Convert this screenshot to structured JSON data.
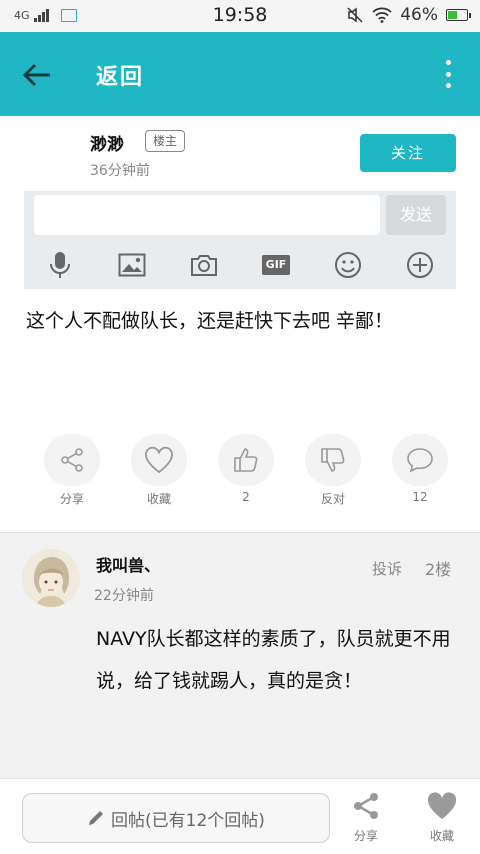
{
  "status_bar": {
    "network": "4G",
    "time": "19:58",
    "battery": "46%",
    "battery_level": 0.46
  },
  "header": {
    "back_icon": "arrow-left-icon",
    "title": "返回",
    "more_icon": "more-vertical-icon",
    "bg_color": "#1fb7c4"
  },
  "post": {
    "author": "渺渺",
    "badge": "楼主",
    "time": "36分钟前",
    "follow_label": "关注",
    "body": "这个人不配做队长，还是赶快下去吧 辛鄙！"
  },
  "composer": {
    "send_label": "发送",
    "tools": [
      "microphone-icon",
      "image-icon",
      "camera-icon",
      "gif-icon",
      "emoji-icon",
      "plus-icon"
    ],
    "gif_label": "GIF"
  },
  "actions": [
    {
      "icon": "share-icon",
      "label": "分享"
    },
    {
      "icon": "heart-icon",
      "label": "收藏"
    },
    {
      "icon": "thumbs-up-icon",
      "label": "2"
    },
    {
      "icon": "thumbs-down-icon",
      "label": "反对"
    },
    {
      "icon": "comment-icon",
      "label": "12"
    }
  ],
  "reply": {
    "author": "我叫兽、",
    "time": "22分钟前",
    "report_label": "投诉",
    "floor": "2楼",
    "body": "NAVY队长都这样的素质了，队员就更不用说，给了钱就踢人，真的是贪！"
  },
  "bottom_bar": {
    "reply_placeholder": "回帖(已有12个回帖)",
    "share_label": "分享",
    "favorite_label": "收藏"
  }
}
